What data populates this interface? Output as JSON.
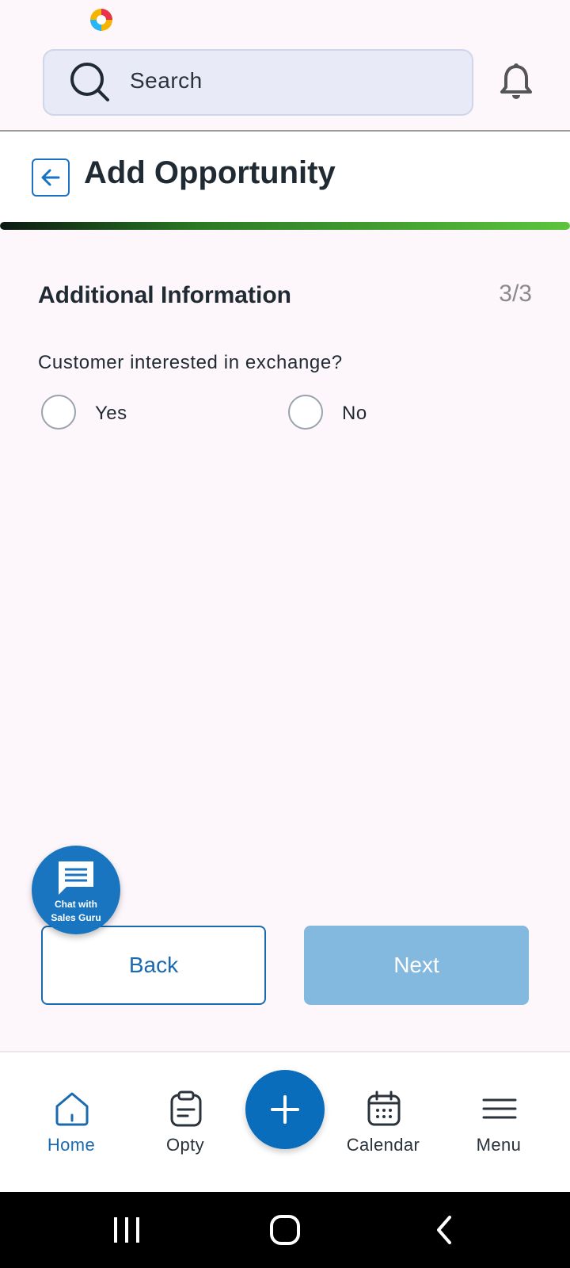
{
  "search": {
    "placeholder": "Search"
  },
  "header": {
    "title": "Add Opportunity",
    "progress": 1.0
  },
  "form": {
    "section_title": "Additional Information",
    "step": "3/3",
    "question": "Customer interested in exchange?",
    "options": [
      {
        "label": "Yes",
        "selected": false
      },
      {
        "label": "No",
        "selected": false
      }
    ]
  },
  "chat": {
    "line1": "Chat with",
    "line2": "Sales Guru"
  },
  "actions": {
    "back_label": "Back",
    "next_label": "Next"
  },
  "bottom_nav": {
    "home": "Home",
    "opty": "Opty",
    "calendar": "Calendar",
    "menu": "Menu",
    "active": "Home"
  },
  "colors": {
    "primary": "#0a6dbc",
    "next_disabled": "#83b8df",
    "progress_end": "#5cc43c"
  },
  "icons": [
    "search-icon",
    "bell-icon",
    "back-arrow-icon",
    "chat-icon",
    "home-icon",
    "clipboard-icon",
    "plus-icon",
    "calendar-icon",
    "hamburger-icon"
  ]
}
